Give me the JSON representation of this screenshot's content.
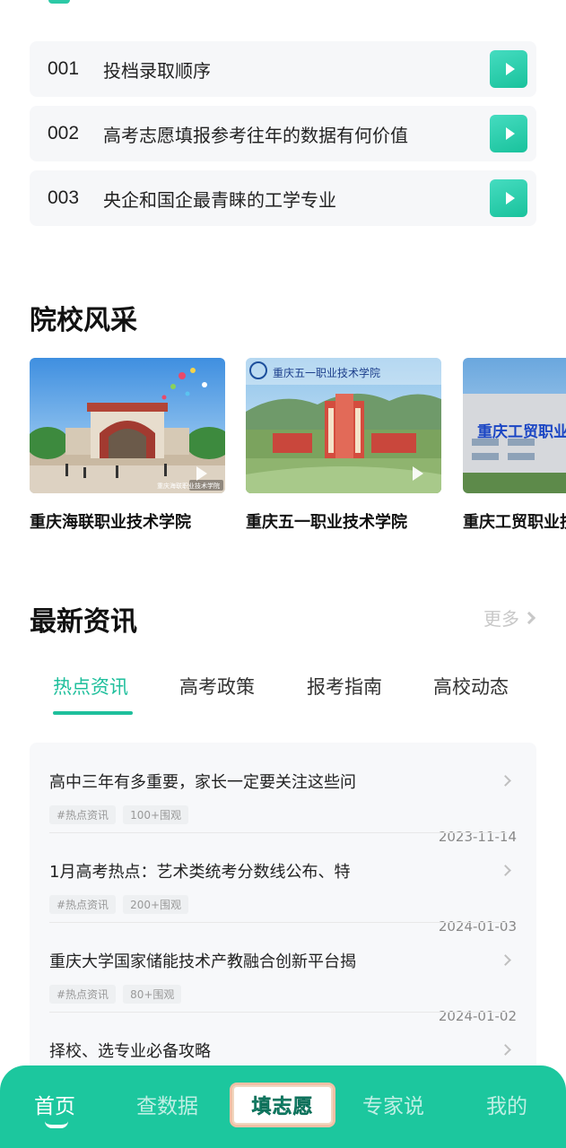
{
  "video_list": [
    {
      "num": "001",
      "title": "投档录取顺序"
    },
    {
      "num": "002",
      "title": "高考志愿填报参考往年的数据有何价值"
    },
    {
      "num": "003",
      "title": "央企和国企最青睐的工学专业"
    }
  ],
  "schools": {
    "title": "院校风采",
    "items": [
      {
        "name": "重庆海联职业技术学院",
        "caption": "重庆海联职业技术学院"
      },
      {
        "name": "重庆五一职业技术学院",
        "banner": "重庆五一职业技术学院"
      },
      {
        "name": "重庆工贸职业技",
        "sign": "重庆工贸职业"
      }
    ]
  },
  "news": {
    "title": "最新资讯",
    "more_label": "更多",
    "tabs": [
      "热点资讯",
      "高考政策",
      "报考指南",
      "高校动态"
    ],
    "active_tab": 0,
    "items": [
      {
        "title": "高中三年有多重要，家长一定要关注这些问",
        "tag": "#热点资讯",
        "views": "100+围观",
        "date": "2023-11-14"
      },
      {
        "title": "1月高考热点：艺术类统考分数线公布、特",
        "tag": "#热点资讯",
        "views": "200+围观",
        "date": "2024-01-03"
      },
      {
        "title": "重庆大学国家储能技术产教融合创新平台揭",
        "tag": "#热点资讯",
        "views": "80+围观",
        "date": "2024-01-02"
      },
      {
        "title": "择校、选专业必备攻略"
      }
    ]
  },
  "tabbar": {
    "items": [
      "首页",
      "查数据",
      "填志愿",
      "专家说",
      "我的"
    ],
    "active": 0
  },
  "colors": {
    "accent": "#1cc79e",
    "accent_text": "#1fbf9c"
  }
}
